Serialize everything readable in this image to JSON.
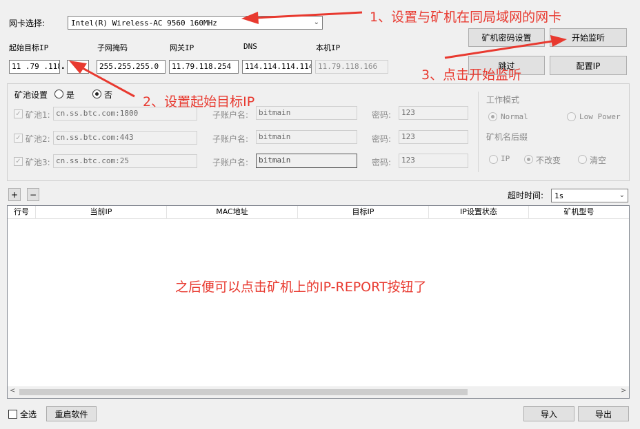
{
  "nic": {
    "label": "网卡选择:",
    "value": "Intel(R) Wireless-AC 9560 160MHz"
  },
  "ip": {
    "start_label": "起始目标IP",
    "start_value": "11 .79 .118",
    "start_last": "",
    "mask_label": "子网掩码",
    "mask_value": "255.255.255.0",
    "gateway_label": "网关IP",
    "gateway_value": "11.79.118.254",
    "dns_label": "DNS",
    "dns_value": "114.114.114.114",
    "local_label": "本机IP",
    "local_value": "11.79.118.166"
  },
  "buttons": {
    "pwd_settings": "矿机密码设置",
    "start_listen": "开始监听",
    "skip": "跳过",
    "config_ip": "配置IP",
    "plus": "+",
    "minus": "−",
    "restart": "重启软件",
    "import": "导入",
    "export": "导出"
  },
  "pool": {
    "label": "矿池设置",
    "opt_yes": "是",
    "opt_no": "否",
    "account_label": "子账户名:",
    "password_label": "密码:",
    "rows": [
      {
        "label": "矿池1:",
        "url": "cn.ss.btc.com:1800",
        "account": "bitmain",
        "password": "123"
      },
      {
        "label": "矿池2:",
        "url": "cn.ss.btc.com:443",
        "account": "bitmain",
        "password": "123"
      },
      {
        "label": "矿池3:",
        "url": "cn.ss.btc.com:25",
        "account": "bitmain",
        "password": "123"
      }
    ]
  },
  "work_mode": {
    "label": "工作模式",
    "normal": "Normal",
    "low_power": "Low Power",
    "suffix_label": "矿机名后缀",
    "suffix_ip": "IP",
    "suffix_keep": "不改变",
    "suffix_clear": "清空"
  },
  "timeout": {
    "label": "超时时间:",
    "value": "1s"
  },
  "table": {
    "columns": [
      "行号",
      "当前IP",
      "MAC地址",
      "目标IP",
      "IP设置状态",
      "矿机型号"
    ]
  },
  "footer": {
    "select_all": "全选"
  },
  "annotations": {
    "step1": "1、设置与矿机在同局域网的网卡",
    "step2": "2、设置起始目标IP",
    "step3": "3、点击开始监听",
    "note": "之后便可以点击矿机上的IP-REPORT按钮了"
  },
  "colors": {
    "annotation": "#e8392f",
    "background": "#f0f0f0"
  }
}
